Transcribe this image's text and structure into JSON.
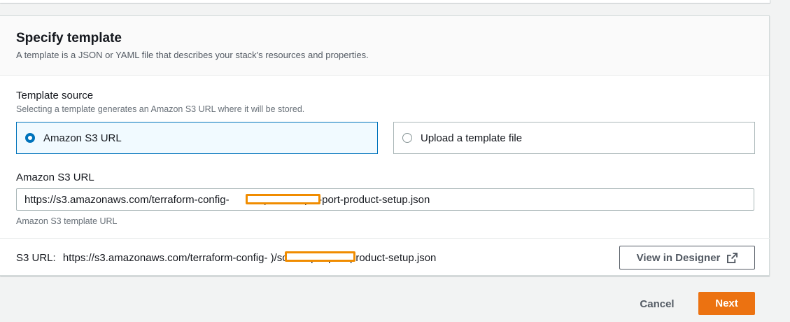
{
  "panel": {
    "title": "Specify template",
    "description": "A template is a JSON or YAML file that describes your stack's resources and properties."
  },
  "template_source": {
    "label": "Template source",
    "description": "Selecting a template generates an Amazon S3 URL where it will be stored.",
    "options": [
      {
        "label": "Amazon S3 URL",
        "selected": true
      },
      {
        "label": "Upload a template file",
        "selected": false
      }
    ]
  },
  "s3_url_field": {
    "label": "Amazon S3 URL",
    "value": "https://s3.amazonaws.com/terraform-config-            )/sc-sample-port-product-setup.json",
    "hint": "Amazon S3 template URL"
  },
  "s3_url_summary": {
    "key": "S3 URL:",
    "value": "https://s3.amazonaws.com/terraform-config-            )/sc-sample-port-product-setup.json"
  },
  "buttons": {
    "view_designer": "View in Designer",
    "cancel": "Cancel",
    "next": "Next"
  },
  "colors": {
    "accent": "#0073bb",
    "primary_button": "#ec7211",
    "redaction_outline": "#f08c00"
  }
}
